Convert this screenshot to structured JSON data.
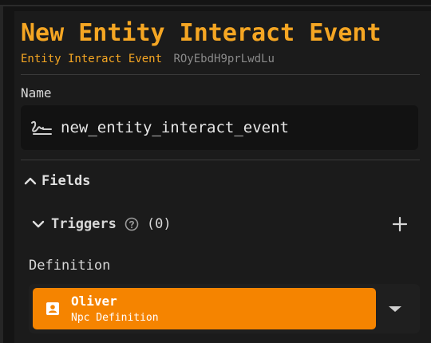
{
  "header": {
    "title": "New Entity Interact Event",
    "entry_type": "Entity Interact Event",
    "entry_id": "ROyEbdH9prLwdLu"
  },
  "name_section": {
    "label": "Name",
    "value": "new_entity_interact_event",
    "icon": "signature-icon"
  },
  "fields_section": {
    "label": "Fields",
    "expanded": true,
    "triggers": {
      "label": "Triggers",
      "count": "(0)",
      "expanded": true,
      "help_icon": "help-circle-icon",
      "add_icon": "plus-icon"
    },
    "definition": {
      "label": "Definition",
      "selected": {
        "title": "Oliver",
        "subtitle": "Npc Definition",
        "icon": "contact-card-icon"
      },
      "dropdown_icon": "caret-down-icon"
    }
  },
  "colors": {
    "accent": "#f5a623",
    "chip": "#f58400",
    "background": "#141414",
    "panel": "#1b1b1b",
    "text": "#e0e0e0",
    "muted": "#8a8a8a"
  }
}
